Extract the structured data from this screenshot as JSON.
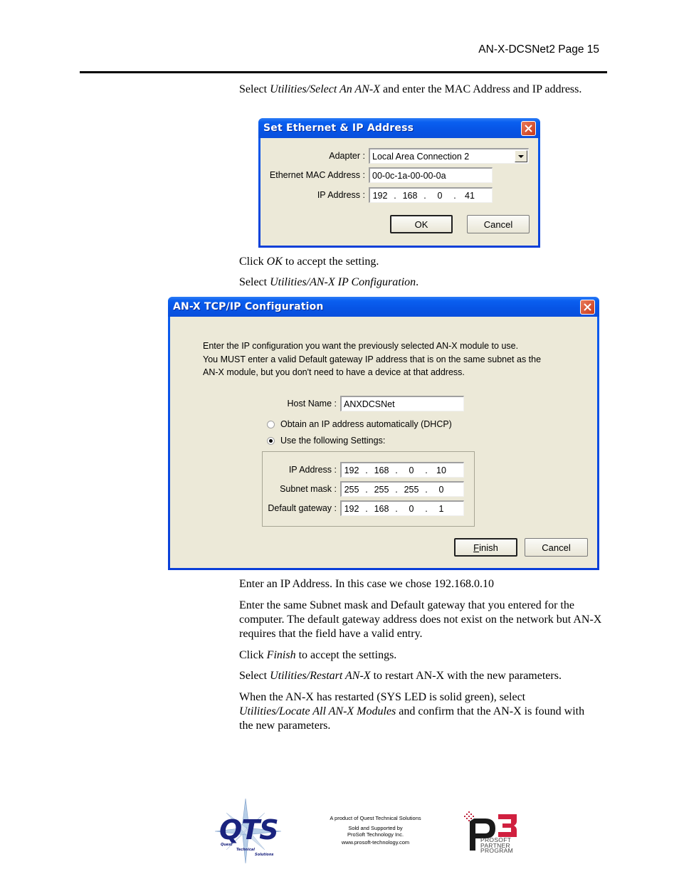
{
  "header": {
    "title": "AN-X-DCSNet2  Page 15"
  },
  "paragraphs": {
    "p1_pre": "Select ",
    "p1_em": "Utilities/Select An AN-X",
    "p1_post": " and enter the MAC Address and IP address.",
    "p2_pre": "Click ",
    "p2_em": "OK",
    "p2_post": " to accept the setting.",
    "p3_pre": "Select ",
    "p3_em": "Utilities/AN-X IP Configuration",
    "p3_post": ".",
    "p4": "Enter an IP Address.  In this case we chose 192.168.0.10",
    "p5": "Enter the same Subnet mask and Default gateway that you entered for the computer.  The default gateway address does not exist on the network but AN-X requires that the field have a valid entry.",
    "p6_pre": "Click ",
    "p6_em": "Finish",
    "p6_post": " to accept the settings.",
    "p7_pre": "Select ",
    "p7_em": "Utilities/Restart AN-X",
    "p7_post": " to restart AN-X with the new parameters.",
    "p8_pre": "When the AN-X has restarted (SYS LED is solid green), select ",
    "p8_em": "Utilities/Locate All AN-X Modules",
    "p8_post": " and confirm that the AN-X is found with the new parameters."
  },
  "dialog1": {
    "title": "Set Ethernet & IP Address",
    "adapter_label": "Adapter :",
    "adapter_value": "Local Area Connection 2",
    "mac_label": "Ethernet MAC Address :",
    "mac_value": "00-0c-1a-00-00-0a",
    "ip_label": "IP Address :",
    "ip": [
      "192",
      "168",
      "0",
      "41"
    ],
    "ok_label": "OK",
    "cancel_label": "Cancel"
  },
  "dialog2": {
    "title": "AN-X TCP/IP Configuration",
    "instructions": [
      "Enter the IP configuration you want the previously selected AN-X module to use.",
      "You MUST enter a valid Default gateway IP address that is on the same subnet as the",
      "AN-X module, but you don't need to have a device at that address."
    ],
    "host_label": "Host Name :",
    "host_value": "ANXDCSNet",
    "radio_dhcp": "Obtain an IP address automatically (DHCP)",
    "radio_static": "Use the following Settings:",
    "selected_option": "static",
    "ip_label": "IP Address :",
    "ip": [
      "192",
      "168",
      "0",
      "10"
    ],
    "subnet_label": "Subnet mask :",
    "subnet": [
      "255",
      "255",
      "255",
      "0"
    ],
    "gateway_label": "Default gateway :",
    "gateway": [
      "192",
      "168",
      "0",
      "1"
    ],
    "finish_mnemonic": "F",
    "finish_rest": "inish",
    "cancel_label": "Cancel"
  },
  "footer": {
    "line1": "A product of Quest Technical Solutions",
    "line2": "Sold and Supported by",
    "line3": "ProSoft Technology Inc.",
    "line4": "www.prosoft-technology.com",
    "qts_logo_text": "QTS",
    "qts_words": [
      "Quest",
      "Technical",
      "Solutions"
    ],
    "p3_logo_text": "P3",
    "p3_words": [
      "PROSOFT",
      "PARTNER",
      "PROGRAM"
    ]
  },
  "colors": {
    "xp_title_blue": "#0a5ff0",
    "xp_face": "#ece9d8",
    "close_red": "#d5502d",
    "qts_navy": "#1a237e",
    "p3_maroon": "#8b1a3a"
  }
}
